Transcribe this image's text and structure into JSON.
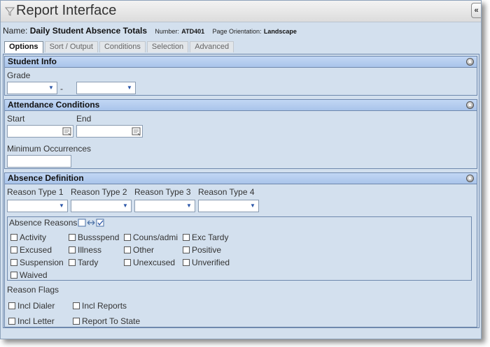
{
  "window": {
    "title": "Report Interface",
    "collapse_label": "«"
  },
  "report": {
    "name_label": "Name:",
    "name_value": "Daily Student Absence Totals",
    "number_label": "Number:",
    "number_value": "ATD401",
    "orientation_label": "Page Orientation:",
    "orientation_value": "Landscape"
  },
  "tabs": [
    "Options",
    "Sort / Output",
    "Conditions",
    "Selection",
    "Advanced"
  ],
  "student_info": {
    "heading": "Student Info",
    "grade_label": "Grade",
    "range_separator": "-",
    "grade_from": "",
    "grade_to": ""
  },
  "attendance": {
    "heading": "Attendance Conditions",
    "start_label": "Start",
    "end_label": "End",
    "start_value": "",
    "end_value": "",
    "min_occurrences_label": "Minimum Occurrences",
    "min_occurrences_value": ""
  },
  "absence": {
    "heading": "Absence Definition",
    "reason_types": [
      "Reason Type 1",
      "Reason Type 2",
      "Reason Type 3",
      "Reason Type 4"
    ],
    "reasons_label": "Absence Reasons",
    "reasons": [
      "Activity",
      "Bussspend",
      "Couns/admi",
      "Exc Tardy",
      "Excused",
      "Illness",
      "Other",
      "Positive",
      "Suspension",
      "Tardy",
      "Unexcused",
      "Unverified",
      "Waived"
    ],
    "flags_label": "Reason Flags",
    "flags": [
      "Incl Dialer",
      "Incl Reports",
      "Incl Letter",
      "Report To State"
    ]
  }
}
